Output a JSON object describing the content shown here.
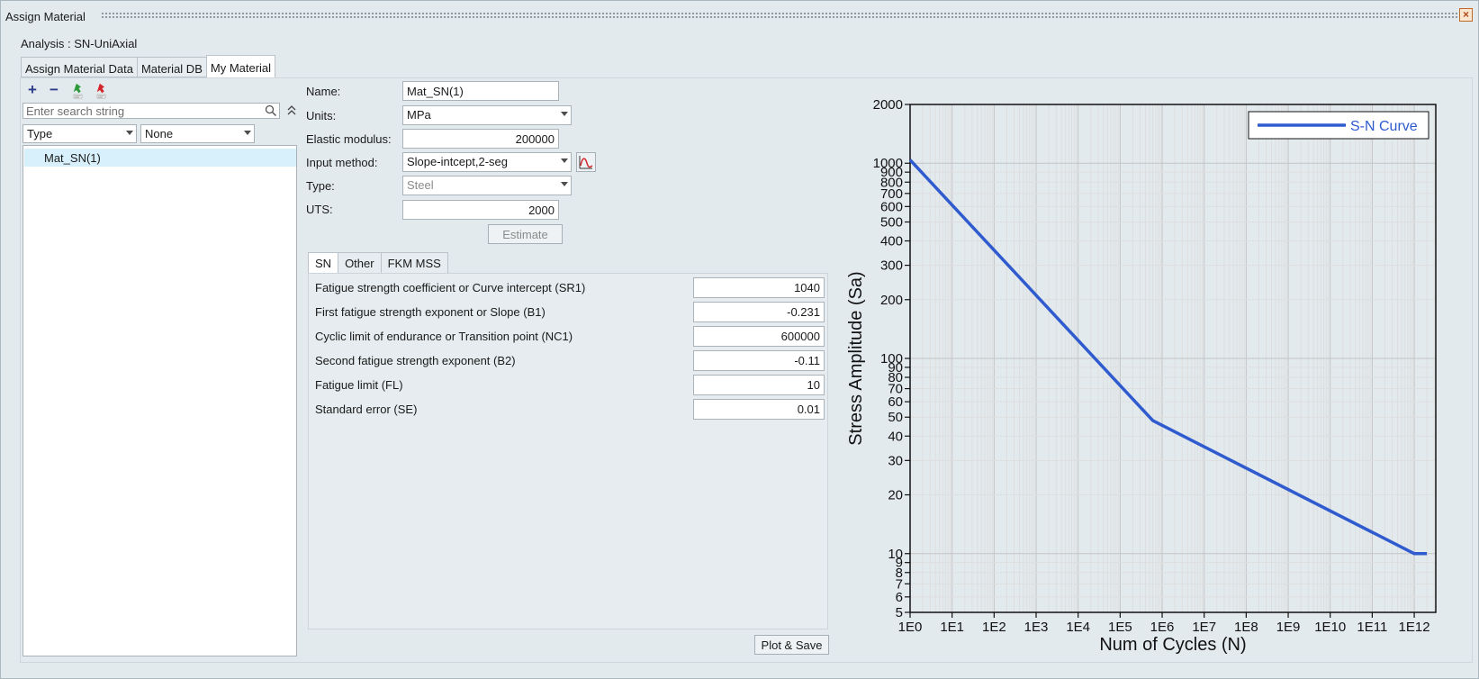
{
  "window": {
    "title": "Assign Material",
    "close_symbol": "×"
  },
  "analysis_label": "Analysis : SN-UniAxial",
  "tabs": [
    {
      "label": "Assign Material Data",
      "active": false
    },
    {
      "label": "Material DB",
      "active": false
    },
    {
      "label": "My Material",
      "active": true
    }
  ],
  "left": {
    "toolbar": {
      "add_symbol": "+",
      "remove_symbol": "−",
      "import_csv_icon": "import-csv-icon",
      "export_csv_icon": "export-csv-icon"
    },
    "search": {
      "placeholder": "Enter search string"
    },
    "filter_field": "Type",
    "filter_value": "None",
    "items": [
      {
        "label": "Mat_SN(1)",
        "selected": true
      }
    ]
  },
  "form": {
    "name_label": "Name:",
    "name_value": "Mat_SN(1)",
    "units_label": "Units:",
    "units_value": "MPa",
    "elastic_label": "Elastic modulus:",
    "elastic_value": "200000",
    "input_method_label": "Input method:",
    "input_method_value": "Slope-intcept,2-seg",
    "type_label": "Type:",
    "type_value": "Steel",
    "uts_label": "UTS:",
    "uts_value": "2000",
    "estimate_label": "Estimate"
  },
  "subtabs": [
    {
      "label": "SN",
      "active": true
    },
    {
      "label": "Other",
      "active": false
    },
    {
      "label": "FKM MSS",
      "active": false
    }
  ],
  "params": [
    {
      "label": "Fatigue strength coefficient or Curve intercept (SR1)",
      "value": "1040"
    },
    {
      "label": "First fatigue strength exponent or Slope (B1)",
      "value": "-0.231"
    },
    {
      "label": "Cyclic limit of endurance or Transition point (NC1)",
      "value": "600000"
    },
    {
      "label": "Second fatigue strength exponent (B2)",
      "value": "-0.11"
    },
    {
      "label": "Fatigue limit (FL)",
      "value": "10"
    },
    {
      "label": "Standard error (SE)",
      "value": "0.01"
    }
  ],
  "plot_save_label": "Plot & Save",
  "colors": {
    "accent": "#2f5bcf",
    "selected_row": "#d8f0fb",
    "background": "#e3eaee"
  },
  "chart_data": {
    "type": "line",
    "title": "",
    "xlabel": "Num of Cycles (N)",
    "ylabel": "Stress Amplitude (Sa)",
    "xscale": "log",
    "yscale": "log",
    "xlim": [
      1,
      1000000000000
    ],
    "ylim": [
      5,
      2000
    ],
    "grid": true,
    "legend": "top-right",
    "x_ticks": [
      "1E0",
      "1E1",
      "1E2",
      "1E3",
      "1E4",
      "1E5",
      "1E6",
      "1E7",
      "1E8",
      "1E9",
      "1E10",
      "1E11",
      "1E12"
    ],
    "y_ticks": [
      "2000",
      "1000",
      "900",
      "800",
      "700",
      "600",
      "500",
      "400",
      "300",
      "200",
      "100",
      "90",
      "80",
      "70",
      "60",
      "50",
      "40",
      "30",
      "20",
      "10",
      "9",
      "8",
      "7",
      "6",
      "5"
    ],
    "series": [
      {
        "name": "S-N Curve",
        "color": "#2f5bcf",
        "x": [
          1,
          600000,
          1000000000000,
          2000000000000
        ],
        "y": [
          1040,
          48,
          10,
          10
        ]
      }
    ]
  }
}
